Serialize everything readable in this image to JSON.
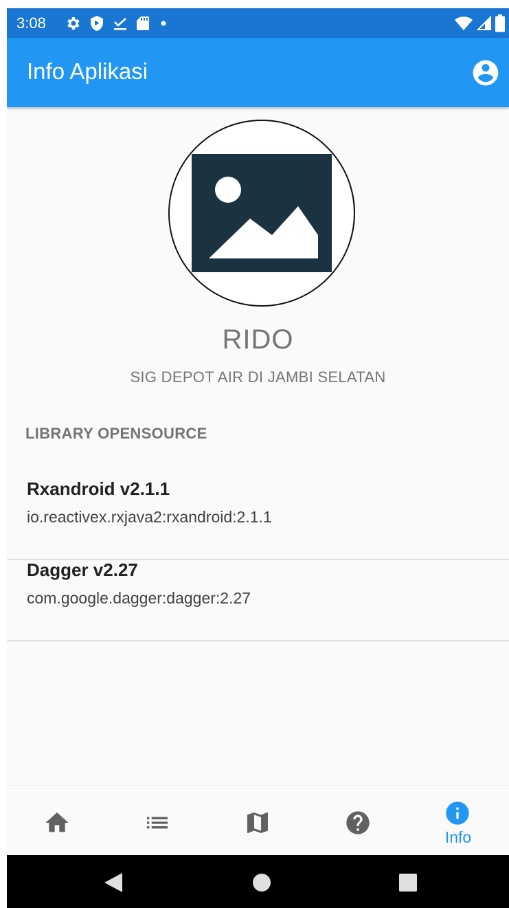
{
  "status_bar": {
    "time": "3:08",
    "icons_left": [
      "gear-icon",
      "shield-play-icon",
      "download-done-icon",
      "sd-card-icon",
      "dot-icon"
    ],
    "icons_right": [
      "wifi-icon",
      "signal-icon",
      "battery-icon"
    ]
  },
  "app_bar": {
    "title": "Info Aplikasi",
    "action_icon": "account-circle-icon"
  },
  "profile": {
    "image_icon": "image-placeholder-icon",
    "name": "RIDO",
    "description": "SIG DEPOT AIR DI JAMBI SELATAN"
  },
  "library_section": {
    "header": "LIBRARY OPENSOURCE",
    "items": [
      {
        "name": "Rxandroid v2.1.1",
        "artifact": "io.reactivex.rxjava2:rxandroid:2.1.1"
      },
      {
        "name": "Dagger v2.27",
        "artifact": "com.google.dagger:dagger:2.27"
      }
    ]
  },
  "bottom_nav": {
    "items": [
      {
        "icon": "home-icon",
        "label": "",
        "active": false
      },
      {
        "icon": "list-icon",
        "label": "",
        "active": false
      },
      {
        "icon": "map-icon",
        "label": "",
        "active": false
      },
      {
        "icon": "help-icon",
        "label": "",
        "active": false
      },
      {
        "icon": "info-icon",
        "label": "Info",
        "active": true
      }
    ]
  },
  "system_nav": {
    "icons": [
      "back-icon",
      "home-circle-icon",
      "recents-icon"
    ]
  },
  "colors": {
    "primary": "#2196f3",
    "primary_dark": "#1976d2",
    "inactive_icon": "#616161",
    "image_dark": "#1b3340"
  }
}
